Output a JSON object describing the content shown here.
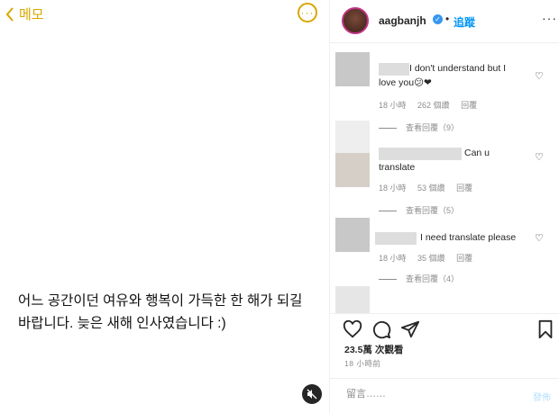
{
  "memo": {
    "back_label": "메모",
    "more_label": "···",
    "note_text_line1": "어느 공간이던 여유와 행복이 가득한 한 해가 되길",
    "note_text_line2": "바랍니다. 늦은 새해 인사였습니다 :)"
  },
  "post": {
    "username": "aagbanjh",
    "verified_mark": "✓",
    "separator": "•",
    "follow_label": "追蹤",
    "more_label": "···",
    "likes": "23.5萬 次觀看",
    "time_ago": "18 小時前",
    "comment_placeholder": "留言……",
    "post_label": "發佈"
  },
  "comments": [
    {
      "text_line1": "I don't understand but I",
      "text_line2": "love you😕❤",
      "time": "18 小時",
      "likes": "262 個讚",
      "reply": "回覆",
      "view_replies": "查看回覆（9）"
    },
    {
      "text_line1": "Can u",
      "text_line2": "translate",
      "time": "18 小時",
      "likes": "53 個讚",
      "reply": "回覆",
      "view_replies": "查看回覆（5）"
    },
    {
      "text_line1": "I need translate please",
      "time": "18 小時",
      "likes": "35 個讚",
      "reply": "回覆",
      "view_replies": "查看回覆（4）"
    }
  ],
  "colors": {
    "memo_accent": "#d9a700",
    "link_blue": "#0095f6",
    "muted_grey": "#8e8e8e"
  }
}
